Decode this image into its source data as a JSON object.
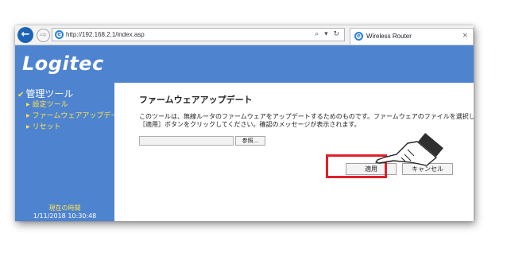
{
  "browser": {
    "url": "http://192.168.2.1/index.asp",
    "tab_title": "Wireless Router",
    "address_tools": "⌕ ▾ ↻",
    "tab_close": "×",
    "back_glyph": "←",
    "forward_glyph": "⇨"
  },
  "header": {
    "logo": "Logitec"
  },
  "sidebar": {
    "menu_title": "管理ツール",
    "items": [
      {
        "label": "設定ツール"
      },
      {
        "label": "ファームウェアアップデート"
      },
      {
        "label": "リセット"
      }
    ],
    "time_label": "現在の時間",
    "time_value": "1/11/2018 10:30:48"
  },
  "main": {
    "title": "ファームウェアアップデート",
    "description": "このツールは、無線ルータのファームウェアをアップデートするためのものです。ファームウェアのファイルを選択し、［適用］ボタンをクリックしてください。確認のメッセージが表示されます。",
    "file_input_value": "",
    "browse_label": "参照...",
    "apply_label": "適用",
    "cancel_label": "キャンセル"
  },
  "colors": {
    "brand_blue": "#4e83d0",
    "menu_yellow": "#ffe34d",
    "highlight_red": "#e0202a"
  },
  "icons": [
    "back-icon",
    "forward-icon",
    "ie-icon",
    "search-icon",
    "refresh-icon",
    "check-icon",
    "arrow-icon",
    "hand-pointer-icon"
  ]
}
